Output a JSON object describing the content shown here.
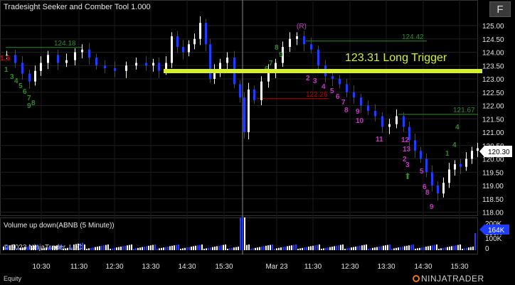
{
  "window": {
    "title": "Tradesight Seeker and Comber Tool 1.000",
    "menu_button": "F"
  },
  "price_panel": {
    "y_ticks": [
      "125.00",
      "124.50",
      "124.00",
      "123.50",
      "123.00",
      "122.50",
      "122.00",
      "121.50",
      "121.00",
      "120.50",
      "120.00",
      "119.50",
      "119.00",
      "118.50",
      "118.00"
    ],
    "current_price": "120.30",
    "levels": [
      {
        "label": "124.18",
        "value": 124.18,
        "color": "#2e8b2e"
      },
      {
        "label": "124.42",
        "value": 124.42,
        "color": "#2e8b2e"
      },
      {
        "label": "122.26",
        "value": 122.26,
        "color": "#c00000"
      },
      {
        "label": "121.67",
        "value": 121.67,
        "color": "#2e8b2e"
      }
    ],
    "trigger": {
      "value": 123.31,
      "label": "123.31 Long Trigger",
      "color": "#d7f028"
    },
    "marker_r": "(R)",
    "arrow_up": "⬆",
    "count_labels": [
      {
        "t": "1.5",
        "c": "#e00000"
      },
      {
        "t": "1",
        "c": "#2e8b2e"
      },
      {
        "t": "3",
        "c": "#2e8b2e"
      },
      {
        "t": "4",
        "c": "#2e8b2e"
      },
      {
        "t": "5",
        "c": "#2e8b2e"
      },
      {
        "t": "6",
        "c": "#2e8b2e"
      },
      {
        "t": "7",
        "c": "#2e8b2e"
      },
      {
        "t": "8",
        "c": "#2e8b2e"
      },
      {
        "t": "9",
        "c": "#2e8b2e"
      },
      {
        "t": "6",
        "c": "#2e8b2e"
      },
      {
        "t": "7",
        "c": "#2e8b2e"
      },
      {
        "t": "8",
        "c": "#2e8b2e"
      },
      {
        "t": "9",
        "c": "#2e8b2e"
      },
      {
        "t": "4",
        "c": "#2e8b2e"
      },
      {
        "t": "2",
        "c": "#cc33cc"
      },
      {
        "t": "3",
        "c": "#cc33cc"
      },
      {
        "t": "4",
        "c": "#cc33cc"
      },
      {
        "t": "5",
        "c": "#cc33cc"
      },
      {
        "t": "6",
        "c": "#cc33cc"
      },
      {
        "t": "7",
        "c": "#cc33cc"
      },
      {
        "t": "8",
        "c": "#cc33cc"
      },
      {
        "t": "9",
        "c": "#cc33cc"
      },
      {
        "t": "10",
        "c": "#cc33cc"
      },
      {
        "t": "11",
        "c": "#cc33cc"
      },
      {
        "t": "12",
        "c": "#cc33cc"
      },
      {
        "t": "13",
        "c": "#cc33cc"
      },
      {
        "t": "2",
        "c": "#cc33cc"
      },
      {
        "t": "3",
        "c": "#cc33cc"
      },
      {
        "t": "5",
        "c": "#cc33cc"
      },
      {
        "t": "6",
        "c": "#cc33cc"
      },
      {
        "t": "8",
        "c": "#cc33cc"
      },
      {
        "t": "9",
        "c": "#cc33cc"
      },
      {
        "t": "1",
        "c": "#2e8b2e"
      },
      {
        "t": "4",
        "c": "#2e8b2e"
      }
    ]
  },
  "volume_panel": {
    "title": "Volume up down(ABNB (5 Minute))",
    "y_ticks": [
      "200K",
      "150K",
      "100K",
      "0"
    ],
    "current_volume": "164K"
  },
  "x_axis": {
    "ticks": [
      "10:30",
      "11:30",
      "12:30",
      "13:30",
      "14:30",
      "15:30",
      "Mar 23",
      "11:30",
      "12:30",
      "13:30",
      "14:30",
      "15:30"
    ]
  },
  "footer": {
    "copyright": "© 2023 NinjaTrader, LLC",
    "instrument_type": "Equity",
    "brand": "NINJATRADER"
  },
  "colors": {
    "up": "#ffffff",
    "down": "#1e3cff",
    "grid": "#2a2a2a",
    "volume_up": "#ffffff",
    "volume_down": "#1e3cff"
  }
}
